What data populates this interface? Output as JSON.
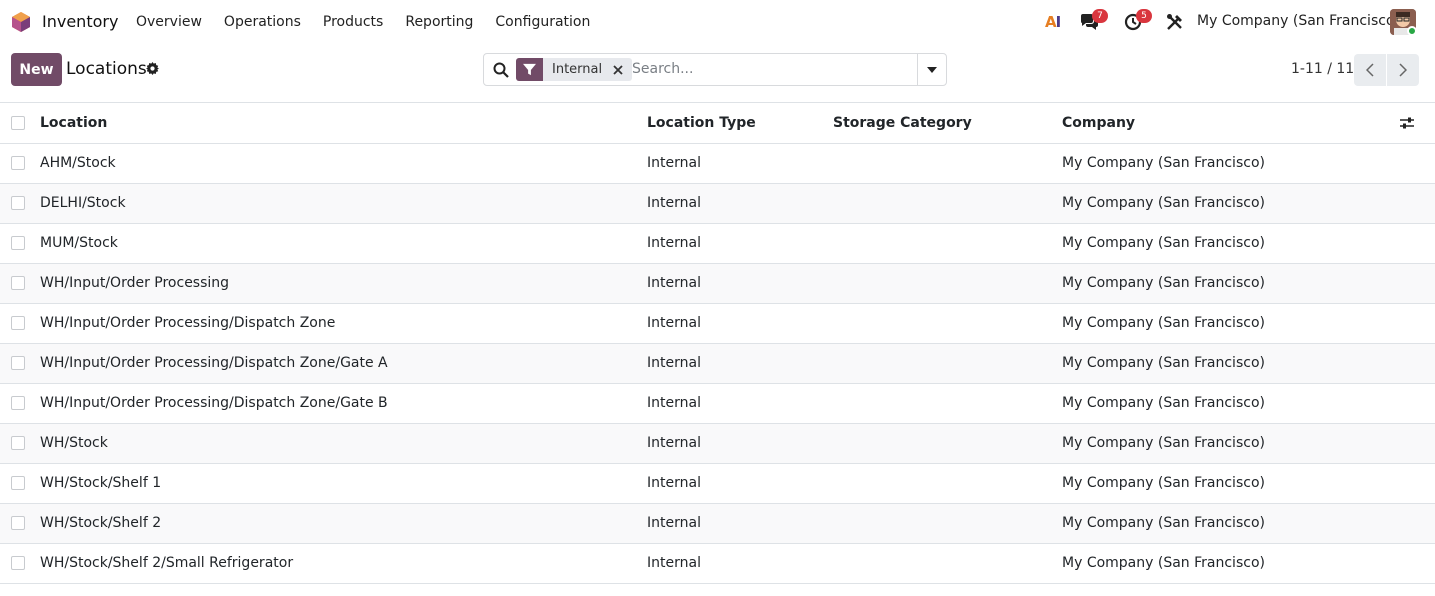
{
  "navbar": {
    "app_name": "Inventory",
    "menu": [
      "Overview",
      "Operations",
      "Products",
      "Reporting",
      "Configuration"
    ],
    "ai_label_a": "A",
    "ai_label_i": "I",
    "messages_count": "7",
    "activities_count": "5",
    "company": "My Company (San Francisco)",
    "icons": [
      "odoo-app-icon",
      "ai-icon",
      "chat-icon",
      "clock-icon",
      "tools-icon",
      "avatar"
    ]
  },
  "control_panel": {
    "new_label": "New",
    "title": "Locations",
    "facet_label": "Internal",
    "search_placeholder": "Search...",
    "pager": "1-11 / 11"
  },
  "colors": {
    "primary": "#714b67",
    "badge": "#d9363e",
    "online": "#28a745"
  },
  "table": {
    "columns": [
      "Location",
      "Location Type",
      "Storage Category",
      "Company"
    ],
    "rows": [
      {
        "location": "AHM/Stock",
        "type": "Internal",
        "category": "",
        "company": "My Company (San Francisco)"
      },
      {
        "location": "DELHI/Stock",
        "type": "Internal",
        "category": "",
        "company": "My Company (San Francisco)"
      },
      {
        "location": "MUM/Stock",
        "type": "Internal",
        "category": "",
        "company": "My Company (San Francisco)"
      },
      {
        "location": "WH/Input/Order Processing",
        "type": "Internal",
        "category": "",
        "company": "My Company (San Francisco)"
      },
      {
        "location": "WH/Input/Order Processing/Dispatch Zone",
        "type": "Internal",
        "category": "",
        "company": "My Company (San Francisco)"
      },
      {
        "location": "WH/Input/Order Processing/Dispatch Zone/Gate A",
        "type": "Internal",
        "category": "",
        "company": "My Company (San Francisco)"
      },
      {
        "location": "WH/Input/Order Processing/Dispatch Zone/Gate B",
        "type": "Internal",
        "category": "",
        "company": "My Company (San Francisco)"
      },
      {
        "location": "WH/Stock",
        "type": "Internal",
        "category": "",
        "company": "My Company (San Francisco)"
      },
      {
        "location": "WH/Stock/Shelf 1",
        "type": "Internal",
        "category": "",
        "company": "My Company (San Francisco)"
      },
      {
        "location": "WH/Stock/Shelf 2",
        "type": "Internal",
        "category": "",
        "company": "My Company (San Francisco)"
      },
      {
        "location": "WH/Stock/Shelf 2/Small Refrigerator",
        "type": "Internal",
        "category": "",
        "company": "My Company (San Francisco)"
      }
    ]
  }
}
